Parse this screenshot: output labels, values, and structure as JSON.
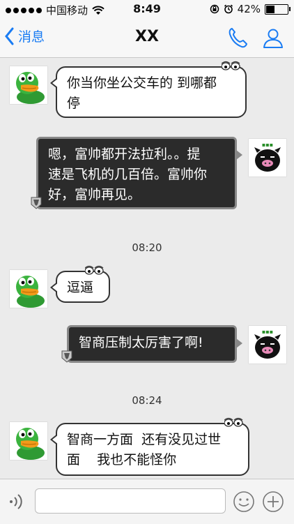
{
  "status_bar": {
    "carrier": "中国移动",
    "time": "8:49",
    "battery_percent": "42%",
    "battery_level": 0.42
  },
  "nav": {
    "back_label": "消息",
    "title": "XX"
  },
  "messages": [
    {
      "side": "left",
      "text_lines": [
        "你当你坐公交车的 到哪都",
        "停"
      ]
    },
    {
      "side": "right",
      "text_lines": [
        "嗯，富帅都开法拉利。。提",
        "速是飞机的几百倍。富帅你",
        "好，富帅再见。"
      ]
    },
    {
      "side": "left",
      "text_lines": [
        "逗逼"
      ]
    },
    {
      "side": "right",
      "text_lines": [
        "智商压制太厉害了啊!"
      ]
    },
    {
      "side": "left",
      "text_lines": [
        "智商一方面  还有没见过世",
        "面    我也不能怪你"
      ]
    }
  ],
  "timestamps": [
    "08:20",
    "08:24"
  ],
  "input": {
    "placeholder": ""
  },
  "colors": {
    "accent": "#1a7cf3",
    "duck_green": "#39b23b",
    "beak_orange": "#f29a1a"
  }
}
